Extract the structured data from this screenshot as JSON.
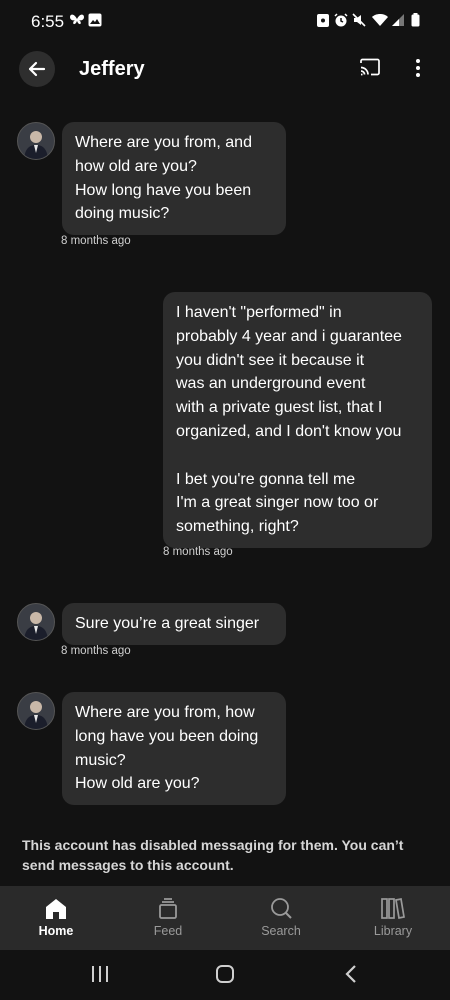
{
  "status_bar": {
    "time": "6:55"
  },
  "header": {
    "title": "Jeffery"
  },
  "messages": [
    {
      "sender": "other",
      "text": "Where are you from, and\nhow old are you?\nHow long have you been\ndoing music?",
      "time": "8 months ago"
    },
    {
      "sender": "self",
      "text": "I haven't \"performed\" in\nprobably 4 year and i guarantee\nyou didn't see it because it\nwas an underground event\nwith a private guest list, that I\norganized, and I don't know you\n\nI bet you're gonna tell me\nI'm a great singer now too or\nsomething, right?",
      "time": "8 months ago"
    },
    {
      "sender": "other",
      "text": "Sure you’re a great singer",
      "time": "8 months ago"
    },
    {
      "sender": "other",
      "text": "Where are you from, how\nlong have you been doing\nmusic?\nHow old are you?",
      "time": ""
    }
  ],
  "notice": "This account has disabled messaging for them. You can’t send messages to this account.",
  "nav": {
    "items": [
      {
        "label": "Home",
        "icon": "home-icon",
        "active": true
      },
      {
        "label": "Feed",
        "icon": "feed-icon",
        "active": false
      },
      {
        "label": "Search",
        "icon": "search-icon",
        "active": false
      },
      {
        "label": "Library",
        "icon": "library-icon",
        "active": false
      }
    ]
  },
  "colors": {
    "background": "#121212",
    "bubble": "#2d2d2d",
    "nav_background": "#2a2a2a",
    "inactive_label": "#9a9a9a"
  }
}
